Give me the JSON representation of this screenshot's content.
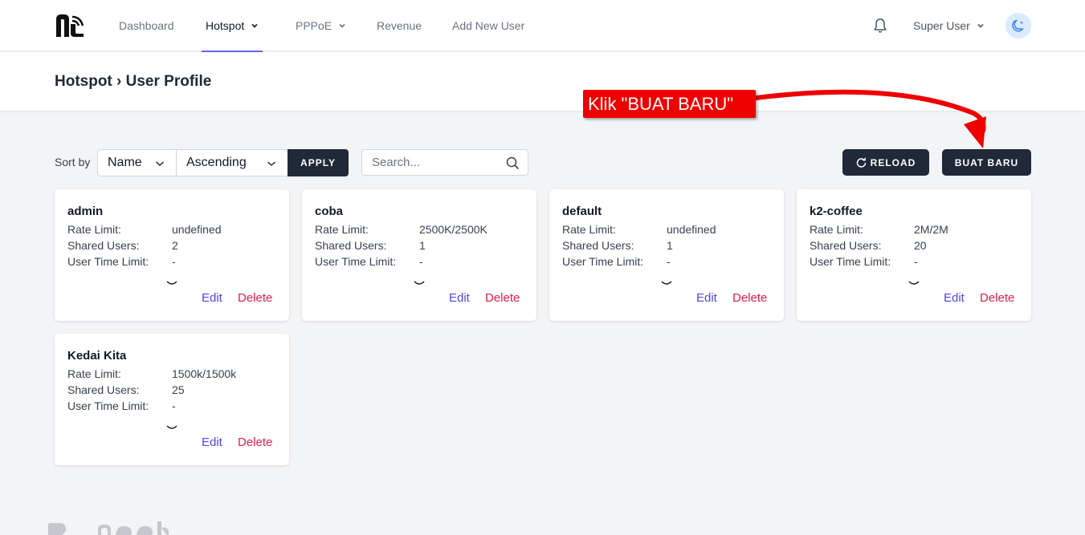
{
  "nav": {
    "items": [
      {
        "label": "Dashboard"
      },
      {
        "label": "Hotspot"
      },
      {
        "label": "PPPoE"
      },
      {
        "label": "Revenue"
      },
      {
        "label": "Add New User"
      }
    ],
    "active": "Hotspot",
    "user_label": "Super User"
  },
  "header": {
    "breadcrumb": "Hotspot › User Profile"
  },
  "toolbar": {
    "sort_label": "Sort by",
    "sort_field": "Name",
    "sort_order": "Ascending",
    "apply_label": "APPLY",
    "search_placeholder": "Search...",
    "reload_label": "RELOAD",
    "create_label": "BUAT BARU"
  },
  "labels": {
    "rate_limit": "Rate Limit:",
    "shared_users": "Shared Users:",
    "user_time_limit": "User Time Limit:",
    "edit": "Edit",
    "delete": "Delete"
  },
  "profiles": [
    {
      "name": "admin",
      "rate_limit": "undefined",
      "shared_users": "2",
      "time_limit": "-"
    },
    {
      "name": "coba",
      "rate_limit": "2500K/2500K",
      "shared_users": "1",
      "time_limit": "-"
    },
    {
      "name": "default",
      "rate_limit": "undefined",
      "shared_users": "1",
      "time_limit": "-"
    },
    {
      "name": "k2-coffee",
      "rate_limit": "2M/2M",
      "shared_users": "20",
      "time_limit": "-"
    },
    {
      "name": "Kedai Kita",
      "rate_limit": "1500k/1500k",
      "shared_users": "25",
      "time_limit": "-"
    }
  ],
  "annotation": {
    "text": "Klik \"BUAT BARU\"",
    "color": "#ee0000"
  },
  "colors": {
    "accent": "#4f46e5",
    "danger": "#e11d48",
    "dark_button": "#1f2937"
  }
}
